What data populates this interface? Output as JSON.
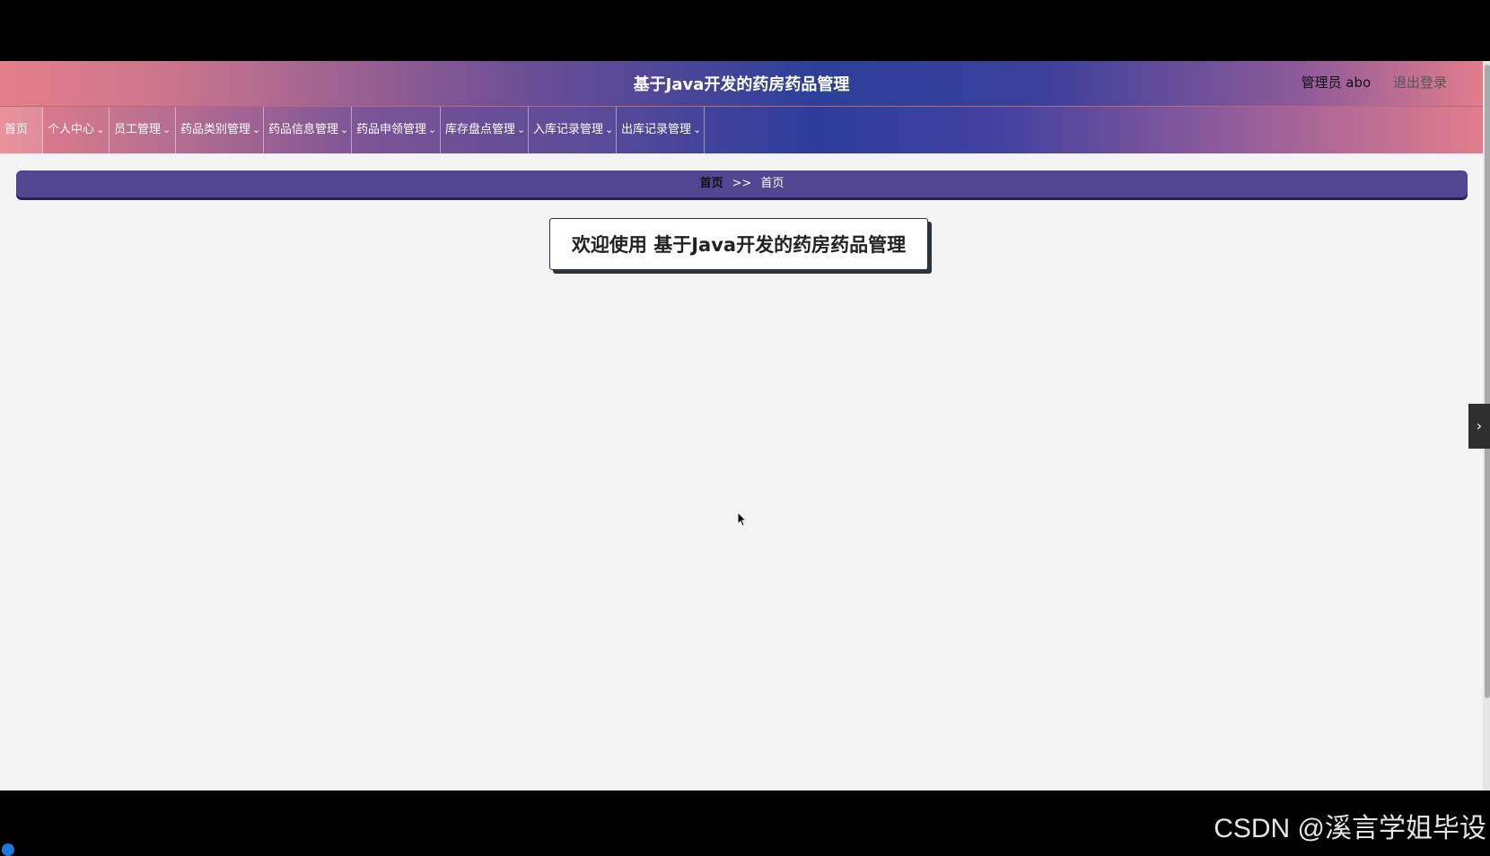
{
  "header": {
    "title": "基于Java开发的药房药品管理",
    "admin_label": "管理员 abo",
    "logout_label": "退出登录"
  },
  "nav": {
    "items": [
      {
        "label": "首页",
        "dropdown": false
      },
      {
        "label": "个人中心",
        "dropdown": true
      },
      {
        "label": "员工管理",
        "dropdown": true
      },
      {
        "label": "药品类别管理",
        "dropdown": true
      },
      {
        "label": "药品信息管理",
        "dropdown": true
      },
      {
        "label": "药品申领管理",
        "dropdown": true
      },
      {
        "label": "库存盘点管理",
        "dropdown": true
      },
      {
        "label": "入库记录管理",
        "dropdown": true
      },
      {
        "label": "出库记录管理",
        "dropdown": true
      }
    ],
    "chevron_glyph": "⌄"
  },
  "breadcrumb": {
    "home": "首页",
    "separator": ">>",
    "current": "首页"
  },
  "welcome": {
    "text": "欢迎使用 基于Java开发的药房药品管理"
  },
  "side_toggle": {
    "glyph": "›"
  },
  "watermark": {
    "text": "CSDN @溪言学姐毕设"
  },
  "colors": {
    "breadcrumb_bg": "#524592",
    "page_bg": "#f3f3f3"
  }
}
